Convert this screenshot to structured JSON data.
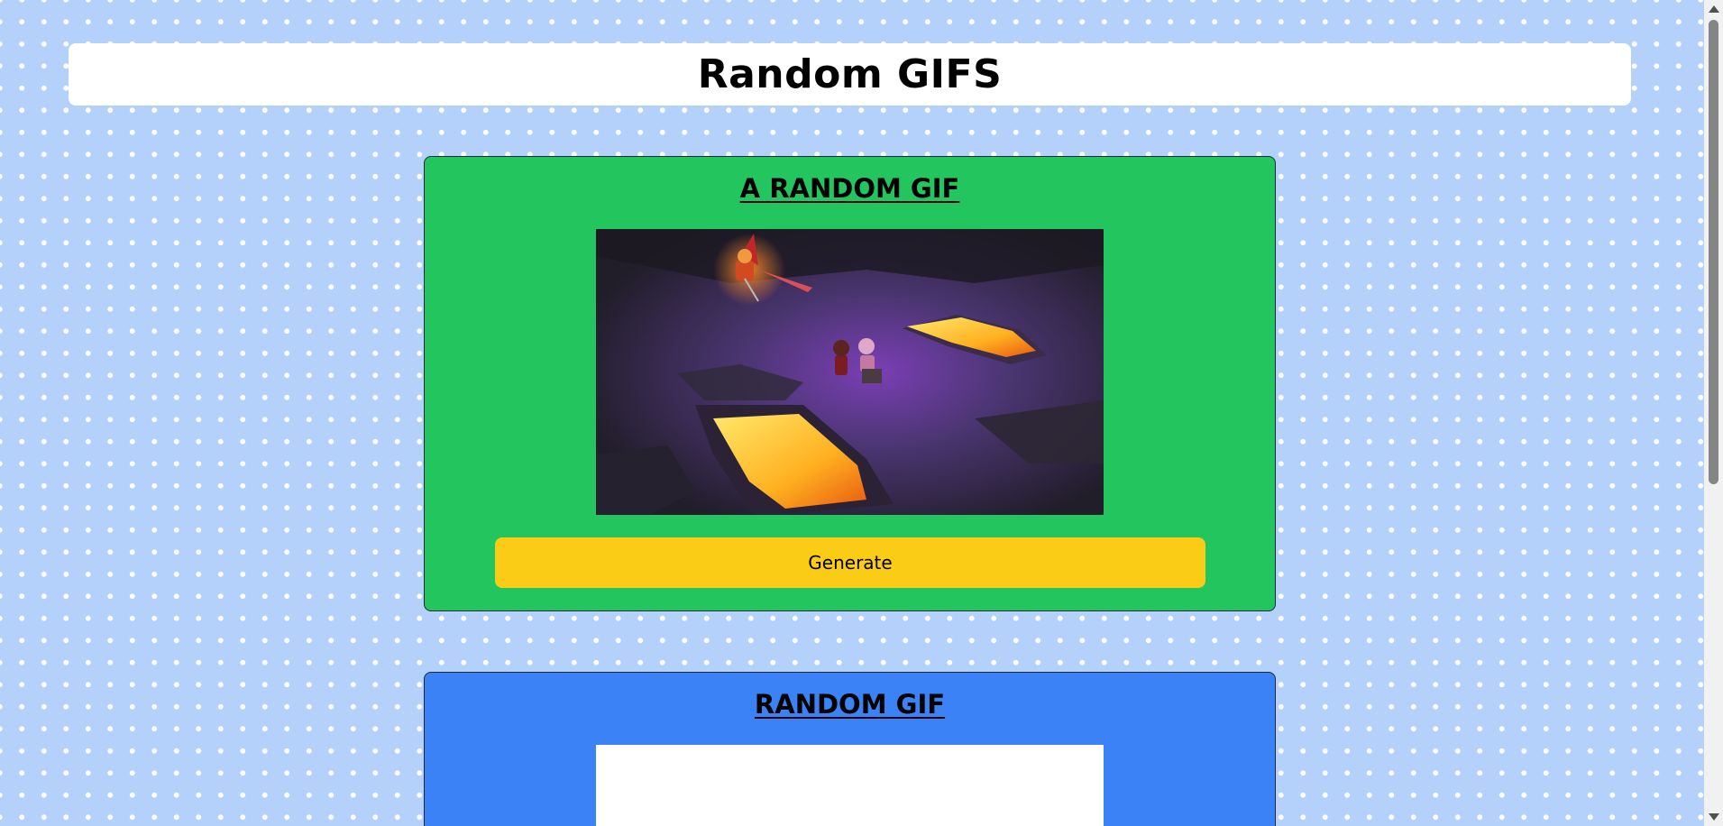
{
  "header": {
    "title": "Random GIFS"
  },
  "cards": [
    {
      "title": "A RANDOM GIF",
      "image_alt": "random-gif",
      "button_label": "Generate",
      "color": "#22c55e"
    },
    {
      "title": "RANDOM GIF",
      "color": "#3b82f6"
    }
  ],
  "colors": {
    "page_background": "#b3d1fb",
    "button": "#facc15"
  }
}
